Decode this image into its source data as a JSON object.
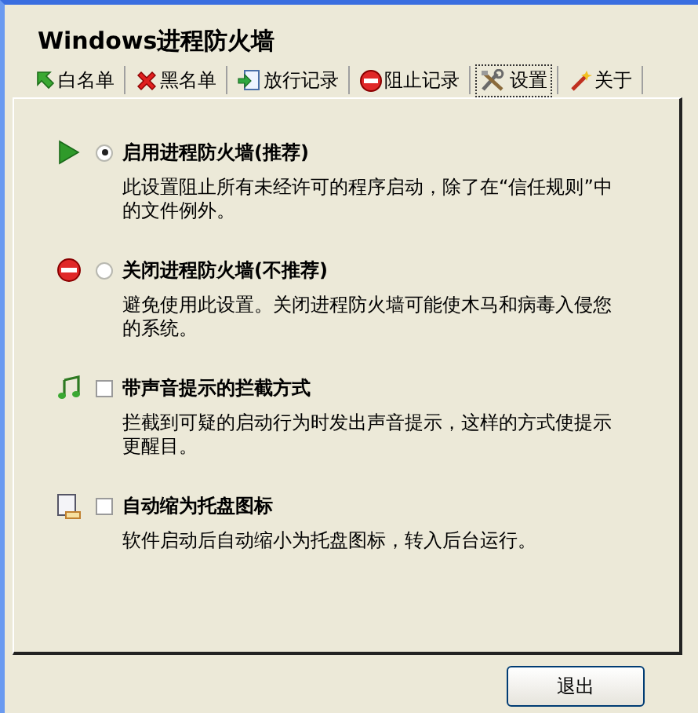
{
  "window": {
    "title": "Windows进程防火墙"
  },
  "tabs": [
    {
      "label": "白名单",
      "selected": false
    },
    {
      "label": "黑名单",
      "selected": false
    },
    {
      "label": "放行记录",
      "selected": false
    },
    {
      "label": "阻止记录",
      "selected": false
    },
    {
      "label": "设置",
      "selected": true
    },
    {
      "label": "关于",
      "selected": false
    }
  ],
  "options": [
    {
      "kind": "radio",
      "label": "启用进程防火墙(推荐)",
      "selected": true,
      "description": "此设置阻止所有未经许可的程序启动，除了在“信任规则”中的文件例外。"
    },
    {
      "kind": "radio",
      "label": "关闭进程防火墙(不推荐)",
      "selected": false,
      "description": "避免使用此设置。关闭进程防火墙可能使木马和病毒入侵您的系统。"
    },
    {
      "kind": "checkbox",
      "label": "带声音提示的拦截方式",
      "checked": false,
      "description": "拦截到可疑的启动行为时发出声音提示，这样的方式使提示更醒目。"
    },
    {
      "kind": "checkbox",
      "label": "自动缩为托盘图标",
      "checked": false,
      "description": "软件启动后自动缩小为托盘图标，转入后台运行。"
    }
  ],
  "buttons": [
    {
      "label": "退出"
    }
  ]
}
